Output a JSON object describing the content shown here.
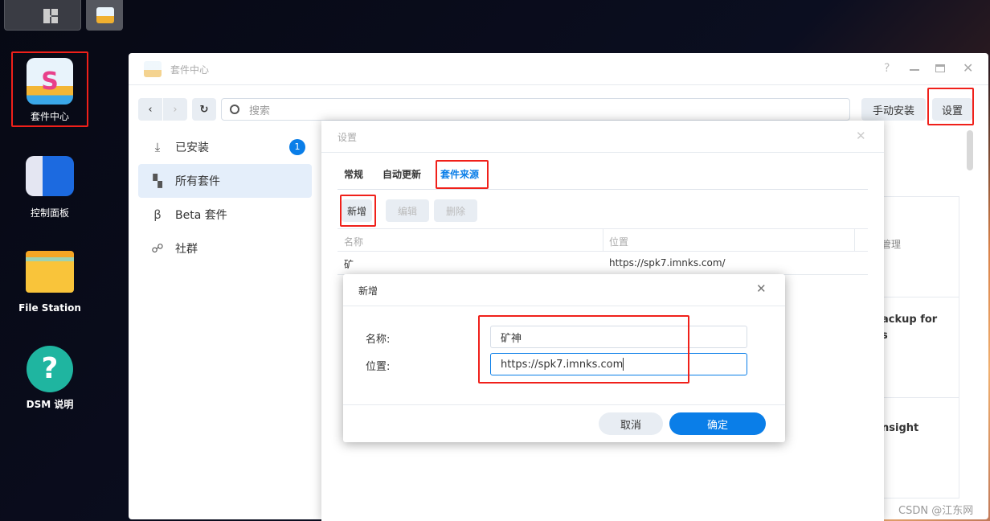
{
  "taskbar": {
    "apps_icon": "grid-icon",
    "package_center_icon": "package-center-icon"
  },
  "desktop": {
    "icons": [
      {
        "label": "套件中心",
        "icon": "package-center-icon"
      },
      {
        "label": "控制面板",
        "icon": "control-panel-icon"
      },
      {
        "label": "File Station",
        "icon": "folder-icon"
      },
      {
        "label": "DSM 说明",
        "icon": "help-icon"
      }
    ]
  },
  "window": {
    "title": "套件中心",
    "search_placeholder": "搜索",
    "manual_install": "手动安装",
    "settings": "设置",
    "sidebar": [
      {
        "label": "已安装",
        "icon": "download-icon",
        "badge": "1"
      },
      {
        "label": "所有套件",
        "icon": "grid-icon"
      },
      {
        "label": "Beta 套件",
        "icon": "beta-icon"
      },
      {
        "label": "社群",
        "icon": "community-icon"
      }
    ],
    "cards": [
      "管理",
      "ackup for",
      "s",
      "nsight"
    ]
  },
  "settings_dialog": {
    "title": "设置",
    "tabs": [
      "常规",
      "自动更新",
      "套件来源"
    ],
    "active_tab": "套件来源",
    "buttons": {
      "add": "新增",
      "edit": "编辑",
      "delete": "删除"
    },
    "columns": [
      "名称",
      "位置"
    ],
    "rows": [
      {
        "name": "矿",
        "location": "https://spk7.imnks.com/"
      }
    ]
  },
  "add_dialog": {
    "title": "新增",
    "name_label": "名称:",
    "location_label": "位置:",
    "name_value": "矿神",
    "location_value": "https://spk7.imnks.com",
    "cancel": "取消",
    "ok": "确定"
  },
  "watermark": "CSDN @江东网",
  "colors": {
    "accent": "#0a7ee8",
    "annotation": "#f0201a"
  }
}
